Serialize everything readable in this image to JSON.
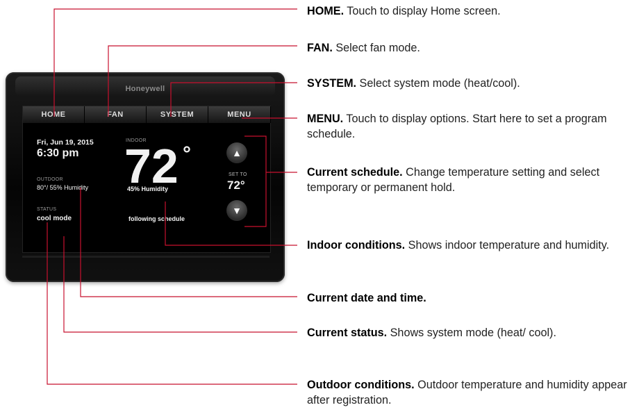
{
  "device": {
    "brand": "Honeywell",
    "tabs": [
      "HOME",
      "FAN",
      "SYSTEM",
      "MENU"
    ],
    "date": "Fri, Jun 19, 2015",
    "time": "6:30 pm",
    "outdoor_label": "OUTDOOR",
    "outdoor_value": "80°/ 55% Humidity",
    "status_label": "STATUS",
    "status_value": "cool mode",
    "indoor_label": "INDOOR",
    "indoor_temp": "72",
    "degree": "°",
    "indoor_humidity": "45% Humidity",
    "schedule_text": "following schedule",
    "set_to_label": "SET TO",
    "set_to_value": "72°",
    "up_glyph": "▲",
    "down_glyph": "▼"
  },
  "callouts": [
    {
      "title": "HOME.",
      "text": " Touch to display Home screen."
    },
    {
      "title": "FAN.",
      "text": " Select fan mode."
    },
    {
      "title": "SYSTEM.",
      "text": " Select system mode (heat/cool)."
    },
    {
      "title": "MENU.",
      "text": " Touch to display options. Start here to set a program schedule."
    },
    {
      "title": "Current schedule.",
      "text": " Change temperature setting and select temporary or permanent hold."
    },
    {
      "title": "Indoor conditions.",
      "text": " Shows indoor temperature and humidity."
    },
    {
      "title": "Current date and time.",
      "text": ""
    },
    {
      "title": "Current status.",
      "text": " Shows system mode (heat/ cool)."
    },
    {
      "title": "Outdoor conditions.",
      "text": " Outdoor temperature and humidity appear after registration."
    }
  ],
  "colors": {
    "leader": "#c8102e"
  }
}
